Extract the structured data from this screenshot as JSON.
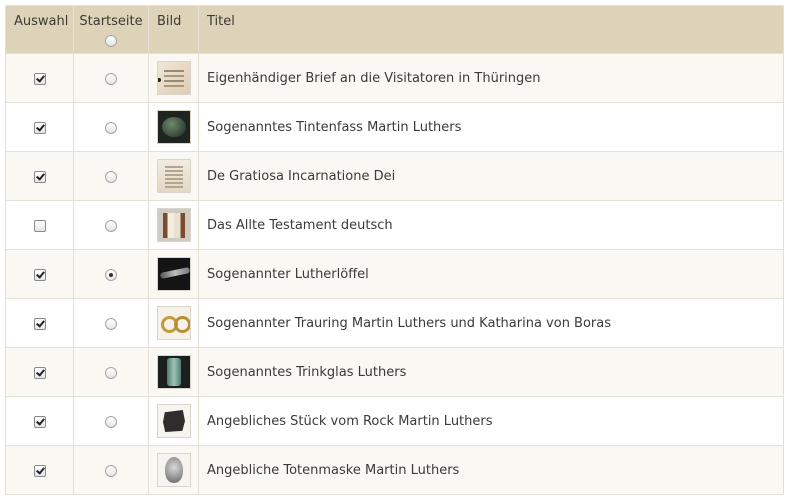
{
  "header": {
    "col_select": "Auswahl",
    "col_startpage": "Startseite",
    "col_image": "Bild",
    "col_title": "Titel"
  },
  "rows": [
    {
      "title": "Eigenhändiger Brief an die Visitatoren in Thüringen",
      "selected": true,
      "start": false,
      "thumb_icon": "letter-thumbnail"
    },
    {
      "title": "Sogenanntes Tintenfass Martin Luthers",
      "selected": true,
      "start": false,
      "thumb_icon": "inkwell-thumbnail"
    },
    {
      "title": "De Gratiosa Incarnatione Dei",
      "selected": true,
      "start": false,
      "thumb_icon": "manuscript-thumbnail"
    },
    {
      "title": "Das Allte Testament deutsch",
      "selected": false,
      "start": false,
      "thumb_icon": "book-thumbnail"
    },
    {
      "title": "Sogenannter Lutherlöffel",
      "selected": true,
      "start": true,
      "thumb_icon": "spoon-thumbnail"
    },
    {
      "title": "Sogenannter Trauring Martin Luthers und Katharina von Boras",
      "selected": true,
      "start": false,
      "thumb_icon": "rings-thumbnail"
    },
    {
      "title": "Sogenanntes Trinkglas Luthers",
      "selected": true,
      "start": false,
      "thumb_icon": "glass-thumbnail"
    },
    {
      "title": "Angebliches Stück vom Rock Martin Luthers",
      "selected": true,
      "start": false,
      "thumb_icon": "fabric-thumbnail"
    },
    {
      "title": "Angebliche Totenmaske Martin Luthers",
      "selected": true,
      "start": false,
      "thumb_icon": "deathmask-thumbnail"
    }
  ],
  "colors": {
    "header_bg": "#dcd3b8",
    "row_alt_bg": "#f9f8f3",
    "border": "#e4e0d6",
    "text": "#3a3a3a"
  }
}
